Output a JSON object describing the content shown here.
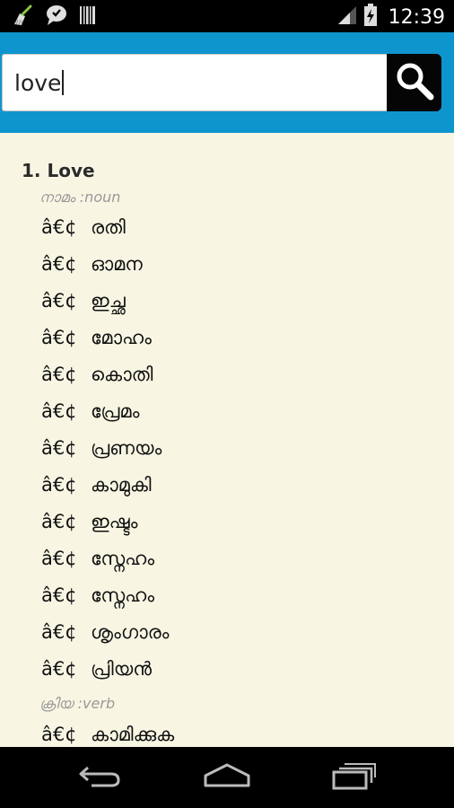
{
  "status_bar": {
    "time": "12:39",
    "icons": [
      "broom-icon",
      "chat-bubble-icon",
      "barcode-icon",
      "signal-icon",
      "battery-charging-icon"
    ]
  },
  "search": {
    "value": "love",
    "button_icon": "search-icon"
  },
  "entry": {
    "title": "1. Love",
    "groups": [
      {
        "pos": "നാമം :noun",
        "meanings": [
          {
            "bullet": "â€¢",
            "text": "രതി"
          },
          {
            "bullet": "â€¢",
            "text": "ഓമന"
          },
          {
            "bullet": "â€¢",
            "text": "ഇച്ഛ"
          },
          {
            "bullet": "â€¢",
            "text": "മോഹം"
          },
          {
            "bullet": "â€¢",
            "text": "കൊതി"
          },
          {
            "bullet": "â€¢",
            "text": "പ്രേമം"
          },
          {
            "bullet": "â€¢",
            "text": "പ്രണയം"
          },
          {
            "bullet": "â€¢",
            "text": "കാമുകി"
          },
          {
            "bullet": "â€¢",
            "text": "ഇഷ്ടം"
          },
          {
            "bullet": "â€¢",
            "text": "സ്നേഹം"
          },
          {
            "bullet": "â€¢",
            "text": "സ്നേഹം"
          },
          {
            "bullet": "â€¢",
            "text": "ശൃംഗാരം"
          },
          {
            "bullet": "â€¢",
            "text": "പ്രിയൻ"
          }
        ]
      },
      {
        "pos": "ക്രിയ :verb",
        "meanings": [
          {
            "bullet": "â€¢",
            "text": "കാമിക്കുക"
          }
        ]
      }
    ]
  },
  "nav_bar": {
    "icons": [
      "back-icon",
      "home-icon",
      "recent-apps-icon"
    ]
  },
  "colors": {
    "header": "#0f95cd",
    "content_bg": "#f8f6e3",
    "status_bar": "#000000"
  }
}
